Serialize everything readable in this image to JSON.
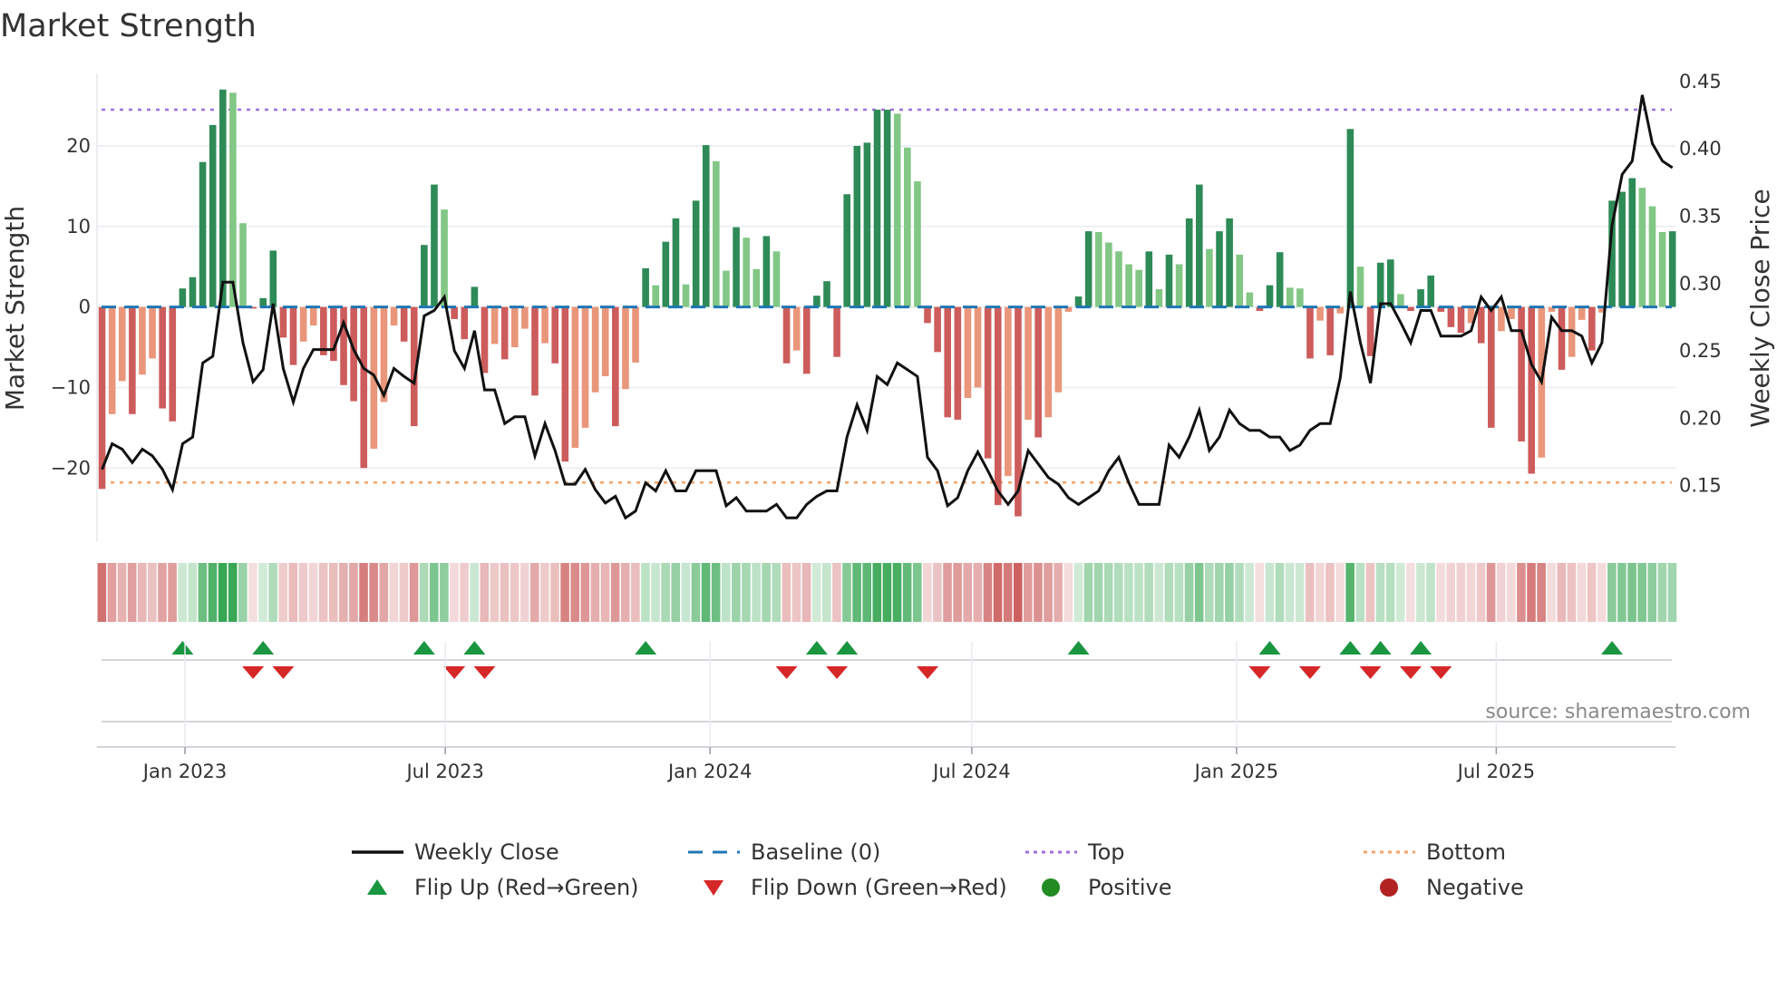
{
  "chart_data": {
    "type": "bar",
    "title": "Market Strength",
    "ylabel": "Market Strength",
    "y2label": "Weekly Close Price",
    "ylim": [
      -29.2,
      29
    ],
    "y2lim": [
      0.108,
      0.456
    ],
    "yticks": [
      -20,
      -10,
      0,
      10,
      20
    ],
    "ytick_labels": [
      "−20",
      "−10",
      "0",
      "10",
      "20"
    ],
    "y2ticks": [
      0.15,
      0.2,
      0.25,
      0.3,
      0.35,
      0.4,
      0.45
    ],
    "y2tick_labels": [
      "0.15",
      "0.20",
      "0.25",
      "0.30",
      "0.35",
      "0.40",
      "0.45"
    ],
    "x_unit": "weeks",
    "xlim_weeks": [
      -0.5,
      156.3
    ],
    "xticks_weeks": [
      8.24,
      34.1,
      60.4,
      86.4,
      112.7,
      138.5
    ],
    "xtick_labels": [
      "Jan 2023",
      "Jul 2023",
      "Jan 2024",
      "Jul 2024",
      "Jan 2025",
      "Jul 2025"
    ],
    "grid": true,
    "top_level": 24.5,
    "bottom_level": -21.8,
    "baseline": 0,
    "strength": [
      -22.6,
      -13.3,
      -9.2,
      -13.3,
      -8.4,
      -6.4,
      -12.6,
      -14.2,
      2.3,
      3.7,
      18,
      22.6,
      27,
      26.6,
      10.4,
      -0.2,
      1.1,
      7,
      -3.8,
      -7.2,
      -4.3,
      -2.3,
      -6,
      -6.7,
      -9.7,
      -11.7,
      -20,
      -17.6,
      -11.8,
      -2.3,
      -4.3,
      -14.8,
      7.7,
      15.2,
      12.1,
      -1.5,
      -4,
      2.5,
      -8.2,
      -4.6,
      -6.5,
      -5,
      -2.7,
      -11,
      -4.5,
      -7,
      -19.2,
      -17.5,
      -15,
      -10.6,
      -8.6,
      -14.8,
      -10.2,
      -6.9,
      4.8,
      2.7,
      8.1,
      11,
      2.8,
      13.2,
      20.1,
      18.1,
      4.5,
      9.9,
      8.6,
      4.7,
      8.8,
      6.9,
      -7,
      -5.4,
      -8.3,
      1.4,
      3.2,
      -6.2,
      14,
      20,
      20.4,
      24.5,
      24.5,
      24,
      19.8,
      15.6,
      -2,
      -5.6,
      -13.7,
      -14,
      -11.3,
      -10,
      -18.8,
      -24.6,
      -21,
      -26,
      -14,
      -16.2,
      -13.7,
      -10.6,
      -0.6,
      1.3,
      9.4,
      9.3,
      8,
      6.9,
      5.3,
      4.6,
      6.9,
      2.2,
      6.5,
      5.3,
      11,
      15.2,
      7.2,
      9.4,
      11,
      6.5,
      1.8,
      -0.5,
      2.7,
      6.8,
      2.4,
      2.3,
      -6.4,
      -1.7,
      -6,
      -0.8,
      22.1,
      5,
      -6.1,
      5.5,
      5.9,
      1.6,
      -0.5,
      2.2,
      3.9,
      -0.6,
      -2.5,
      -3.2,
      -2,
      -4.5,
      -15,
      -3,
      -1.5,
      -16.7,
      -20.7,
      -18.7,
      -0.6,
      -7.8,
      -6.2,
      -1.6,
      -5.4,
      -0.7,
      13.2,
      14.3,
      16,
      14.8,
      12.5,
      9.3,
      9.4
    ],
    "weekly_close": [
      0.162,
      0.181,
      0.177,
      0.167,
      0.177,
      0.172,
      0.162,
      0.147,
      0.181,
      0.186,
      0.241,
      0.246,
      0.301,
      0.301,
      0.256,
      0.227,
      0.236,
      0.285,
      0.237,
      0.212,
      0.237,
      0.251,
      0.251,
      0.251,
      0.271,
      0.251,
      0.237,
      0.232,
      0.217,
      0.237,
      0.231,
      0.226,
      0.276,
      0.28,
      0.29,
      0.25,
      0.237,
      0.265,
      0.221,
      0.221,
      0.196,
      0.201,
      0.201,
      0.172,
      0.196,
      0.176,
      0.151,
      0.151,
      0.162,
      0.147,
      0.137,
      0.142,
      0.126,
      0.131,
      0.152,
      0.146,
      0.161,
      0.146,
      0.146,
      0.161,
      0.161,
      0.161,
      0.135,
      0.141,
      0.131,
      0.131,
      0.131,
      0.136,
      0.126,
      0.126,
      0.136,
      0.142,
      0.146,
      0.146,
      0.186,
      0.21,
      0.191,
      0.231,
      0.225,
      0.241,
      0.236,
      0.231,
      0.171,
      0.161,
      0.135,
      0.141,
      0.161,
      0.175,
      0.161,
      0.146,
      0.136,
      0.146,
      0.176,
      0.166,
      0.156,
      0.151,
      0.141,
      0.136,
      0.141,
      0.146,
      0.161,
      0.171,
      0.152,
      0.136,
      0.136,
      0.136,
      0.18,
      0.171,
      0.186,
      0.206,
      0.176,
      0.186,
      0.206,
      0.196,
      0.191,
      0.191,
      0.186,
      0.186,
      0.176,
      0.18,
      0.191,
      0.196,
      0.196,
      0.23,
      0.294,
      0.256,
      0.226,
      0.285,
      0.285,
      0.271,
      0.256,
      0.28,
      0.28,
      0.261,
      0.261,
      0.261,
      0.265,
      0.29,
      0.28,
      0.29,
      0.265,
      0.265,
      0.24,
      0.227,
      0.275,
      0.265,
      0.265,
      0.261,
      0.241,
      0.256,
      0.343,
      0.381,
      0.391,
      0.44,
      0.404,
      0.391,
      0.386
    ],
    "legend": {
      "position": "bottom",
      "items": [
        {
          "label": "Weekly Close",
          "kind": "line-solid",
          "color": "#111111"
        },
        {
          "label": "Baseline (0)",
          "kind": "line-dashed",
          "color": "#1f77b4"
        },
        {
          "label": "Top",
          "kind": "line-dotted",
          "color": "#a06ee0"
        },
        {
          "label": "Bottom",
          "kind": "line-dotted",
          "color": "#f2a46a"
        },
        {
          "label": "Flip Up (Red→Green)",
          "kind": "triangle-up",
          "color": "#1a9641"
        },
        {
          "label": "Flip Down (Green→Red)",
          "kind": "triangle-down",
          "color": "#d62728"
        },
        {
          "label": "Positive",
          "kind": "circle",
          "color": "#228b22"
        },
        {
          "label": "Negative",
          "kind": "circle",
          "color": "#b22222"
        }
      ]
    },
    "colors": {
      "pos_rising": "#2e8b57",
      "pos_falling": "#82c785",
      "neg_falling": "#cd5c5c",
      "neg_rising": "#e9967a",
      "close_line": "#111111",
      "baseline": "#1f77b4",
      "top": "#a06ee0",
      "bottom": "#f2a46a",
      "flip_up": "#1a9641",
      "flip_down": "#d62728"
    },
    "source": "source: sharemaestro.com"
  }
}
